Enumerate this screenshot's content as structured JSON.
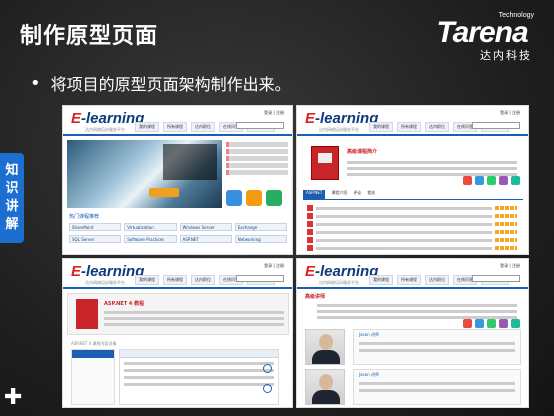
{
  "slide": {
    "title": "制作原型页面",
    "bullet": "将项目的原型页面架构制作出来。",
    "side_tab": [
      "知",
      "识",
      "讲",
      "解"
    ],
    "logo": {
      "tech": "Technology",
      "brand_e": "T",
      "brand_rest": "arena",
      "sub": "达内科技"
    }
  },
  "thumbnails": {
    "brand_e": "E",
    "brand_rest": "-learning",
    "brand_sub": "达内网络培训服务平台",
    "nav": [
      "我的课程",
      "所有课程",
      "达内职位",
      "在线问答",
      "服务与帮助"
    ],
    "top_links": "登录 | 注册",
    "home": {
      "section_label": "热门课程推荐",
      "categories": [
        "SharePoint",
        "Virtualization",
        "Windows Server",
        "Exchange",
        "SQL Server",
        "Software Practices",
        "ASP.NET",
        "Networking"
      ]
    },
    "course": {
      "title": "高级课程简介",
      "tabs": [
        "ASP.NET",
        "课程介绍",
        "评论",
        "相关"
      ]
    },
    "detail": {
      "title": "ASP.NET 4 教程",
      "sub": "ASP.NET 4 课程内容详情"
    },
    "teacher": {
      "section": "高级讲师",
      "names": [
        "Jason 讲师",
        "Jason 讲师"
      ]
    }
  }
}
